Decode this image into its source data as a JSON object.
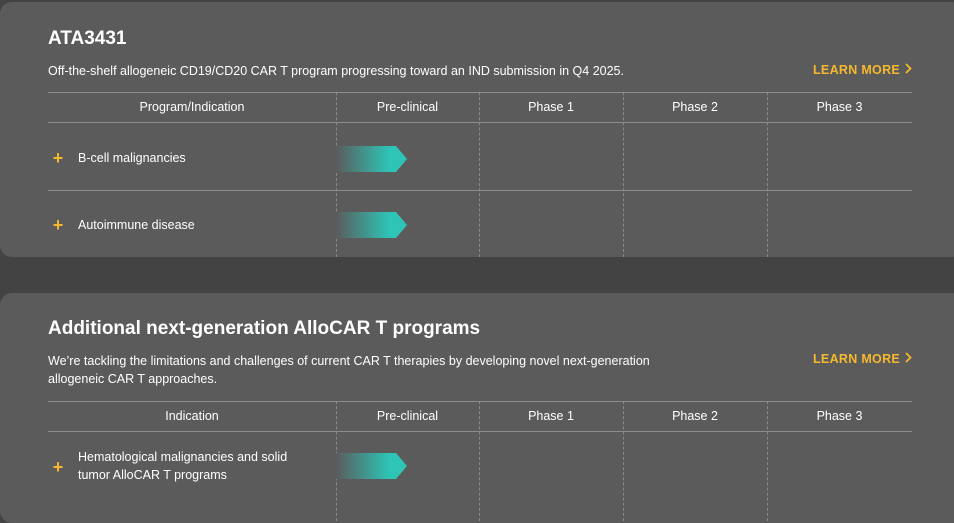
{
  "cards": [
    {
      "title": "ATA3431",
      "description": "Off-the-shelf allogeneic CD19/CD20 CAR T program progressing toward an IND submission in Q4 2025.",
      "learn_more": "LEARN MORE",
      "headers": [
        "Program/Indication",
        "Pre-clinical",
        "Phase 1",
        "Phase 2",
        "Phase 3"
      ],
      "rows": [
        {
          "label": "B-cell malignancies",
          "stage": "Pre-clinical"
        },
        {
          "label": "Autoimmune disease",
          "stage": "Pre-clinical"
        }
      ]
    },
    {
      "title": "Additional next-generation AlloCAR T programs",
      "description_line1": "We’re tackling the limitations and challenges of current CAR T therapies by developing novel next-generation",
      "description_line2": "allogeneic CAR T approaches.",
      "learn_more": "LEARN MORE",
      "headers": [
        "Indication",
        "Pre-clinical",
        "Phase 1",
        "Phase 2",
        "Phase 3"
      ],
      "rows": [
        {
          "label_line1": "Hematological malignancies and solid",
          "label_line2": "tumor AlloCAR T programs",
          "stage": "Pre-clinical"
        }
      ]
    }
  ],
  "colors": {
    "accent": "#f5b82e",
    "progress_start": "#5b5b5c",
    "progress_end": "#2ec4b6"
  },
  "icons": {
    "expand": "plus-icon",
    "learn_more": "chevron-right-icon"
  }
}
